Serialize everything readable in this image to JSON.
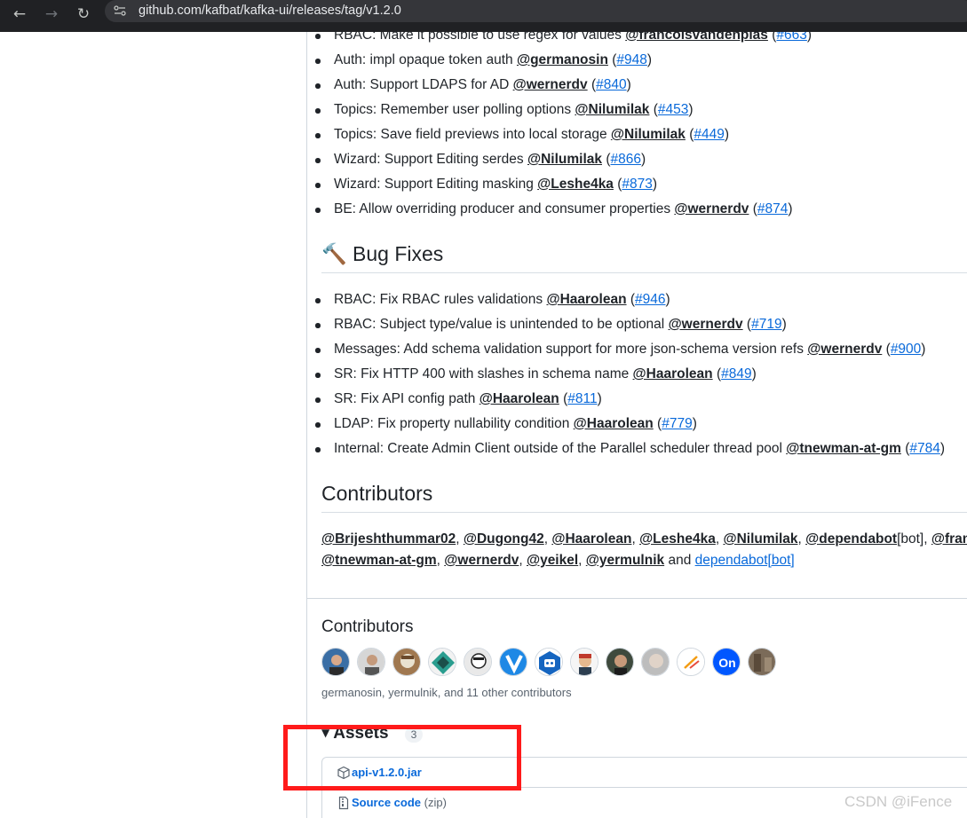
{
  "browser": {
    "url": "github.com/kafbat/kafka-ui/releases/tag/v1.2.0"
  },
  "features": [
    {
      "text": "RBAC: Make it possible to use regex for values ",
      "user": "@francoisvandenplas",
      "issue": "#663"
    },
    {
      "text": "Auth: impl opaque token auth ",
      "user": "@germanosin",
      "issue": "#948"
    },
    {
      "text": "Auth: Support LDAPS for AD ",
      "user": "@wernerdv",
      "issue": "#840"
    },
    {
      "text": "Topics: Remember user polling options ",
      "user": "@Nilumilak",
      "issue": "#453"
    },
    {
      "text": "Topics: Save field previews into local storage ",
      "user": "@Nilumilak",
      "issue": "#449"
    },
    {
      "text": "Wizard: Support Editing serdes ",
      "user": "@Nilumilak",
      "issue": "#866"
    },
    {
      "text": "Wizard: Support Editing masking ",
      "user": "@Leshe4ka",
      "issue": "#873"
    },
    {
      "text": "BE: Allow overriding producer and consumer properties ",
      "user": "@wernerdv",
      "issue": "#874"
    }
  ],
  "bug_fixes": {
    "emoji": "🔨",
    "title": "Bug Fixes",
    "items": [
      {
        "text": "RBAC: Fix RBAC rules validations ",
        "user": "@Haarolean",
        "issue": "#946"
      },
      {
        "text": "RBAC: Subject type/value is unintended to be optional ",
        "user": "@wernerdv",
        "issue": "#719"
      },
      {
        "text": "Messages: Add schema validation support for more json-schema version refs ",
        "user": "@wernerdv",
        "issue": "#900"
      },
      {
        "text": "SR: Fix HTTP 400 with slashes in schema name ",
        "user": "@Haarolean",
        "issue": "#849"
      },
      {
        "text": "SR: Fix API config path ",
        "user": "@Haarolean",
        "issue": "#811"
      },
      {
        "text": "LDAP: Fix property nullability condition ",
        "user": "@Haarolean",
        "issue": "#779"
      },
      {
        "text": "Internal: Create Admin Client outside of the Parallel scheduler thread pool ",
        "user": "@tnewman-at-gm",
        "issue": "#784"
      }
    ]
  },
  "contributors_notes": {
    "title": "Contributors",
    "line1": [
      "@Brijeshthummar02",
      "@Dugong42",
      "@Haarolean",
      "@Leshe4ka",
      "@Nilumilak",
      "@dependabot"
    ],
    "line1_bot": "[bot]",
    "line1_tail": "@fran",
    "line2": [
      "@tnewman-at-gm",
      "@wernerdv",
      "@yeikel",
      "@yermulnik"
    ],
    "and_word": "and",
    "dependabot_link": "dependabot[bot]"
  },
  "contributors_section": {
    "title": "Contributors",
    "caption": "germanosin, yermulnik, and 11 other contributors",
    "avatar_colors": [
      "#3a6ea5",
      "#5b5b5b",
      "#a07850",
      "#2a9d8f",
      "#e9e9e9",
      "#1e88e5",
      "#1565c0",
      "#c0392b",
      "#3e4a3d",
      "#bdbdbd",
      "#ffffff",
      "#0057ff",
      "#7b6b59"
    ]
  },
  "assets": {
    "title": "Assets",
    "count": "3",
    "files": [
      {
        "name": "api-v1.2.0.jar",
        "suffix": ""
      },
      {
        "name": "Source code",
        "suffix": "(zip)"
      }
    ]
  },
  "watermark": "CSDN @iFence"
}
